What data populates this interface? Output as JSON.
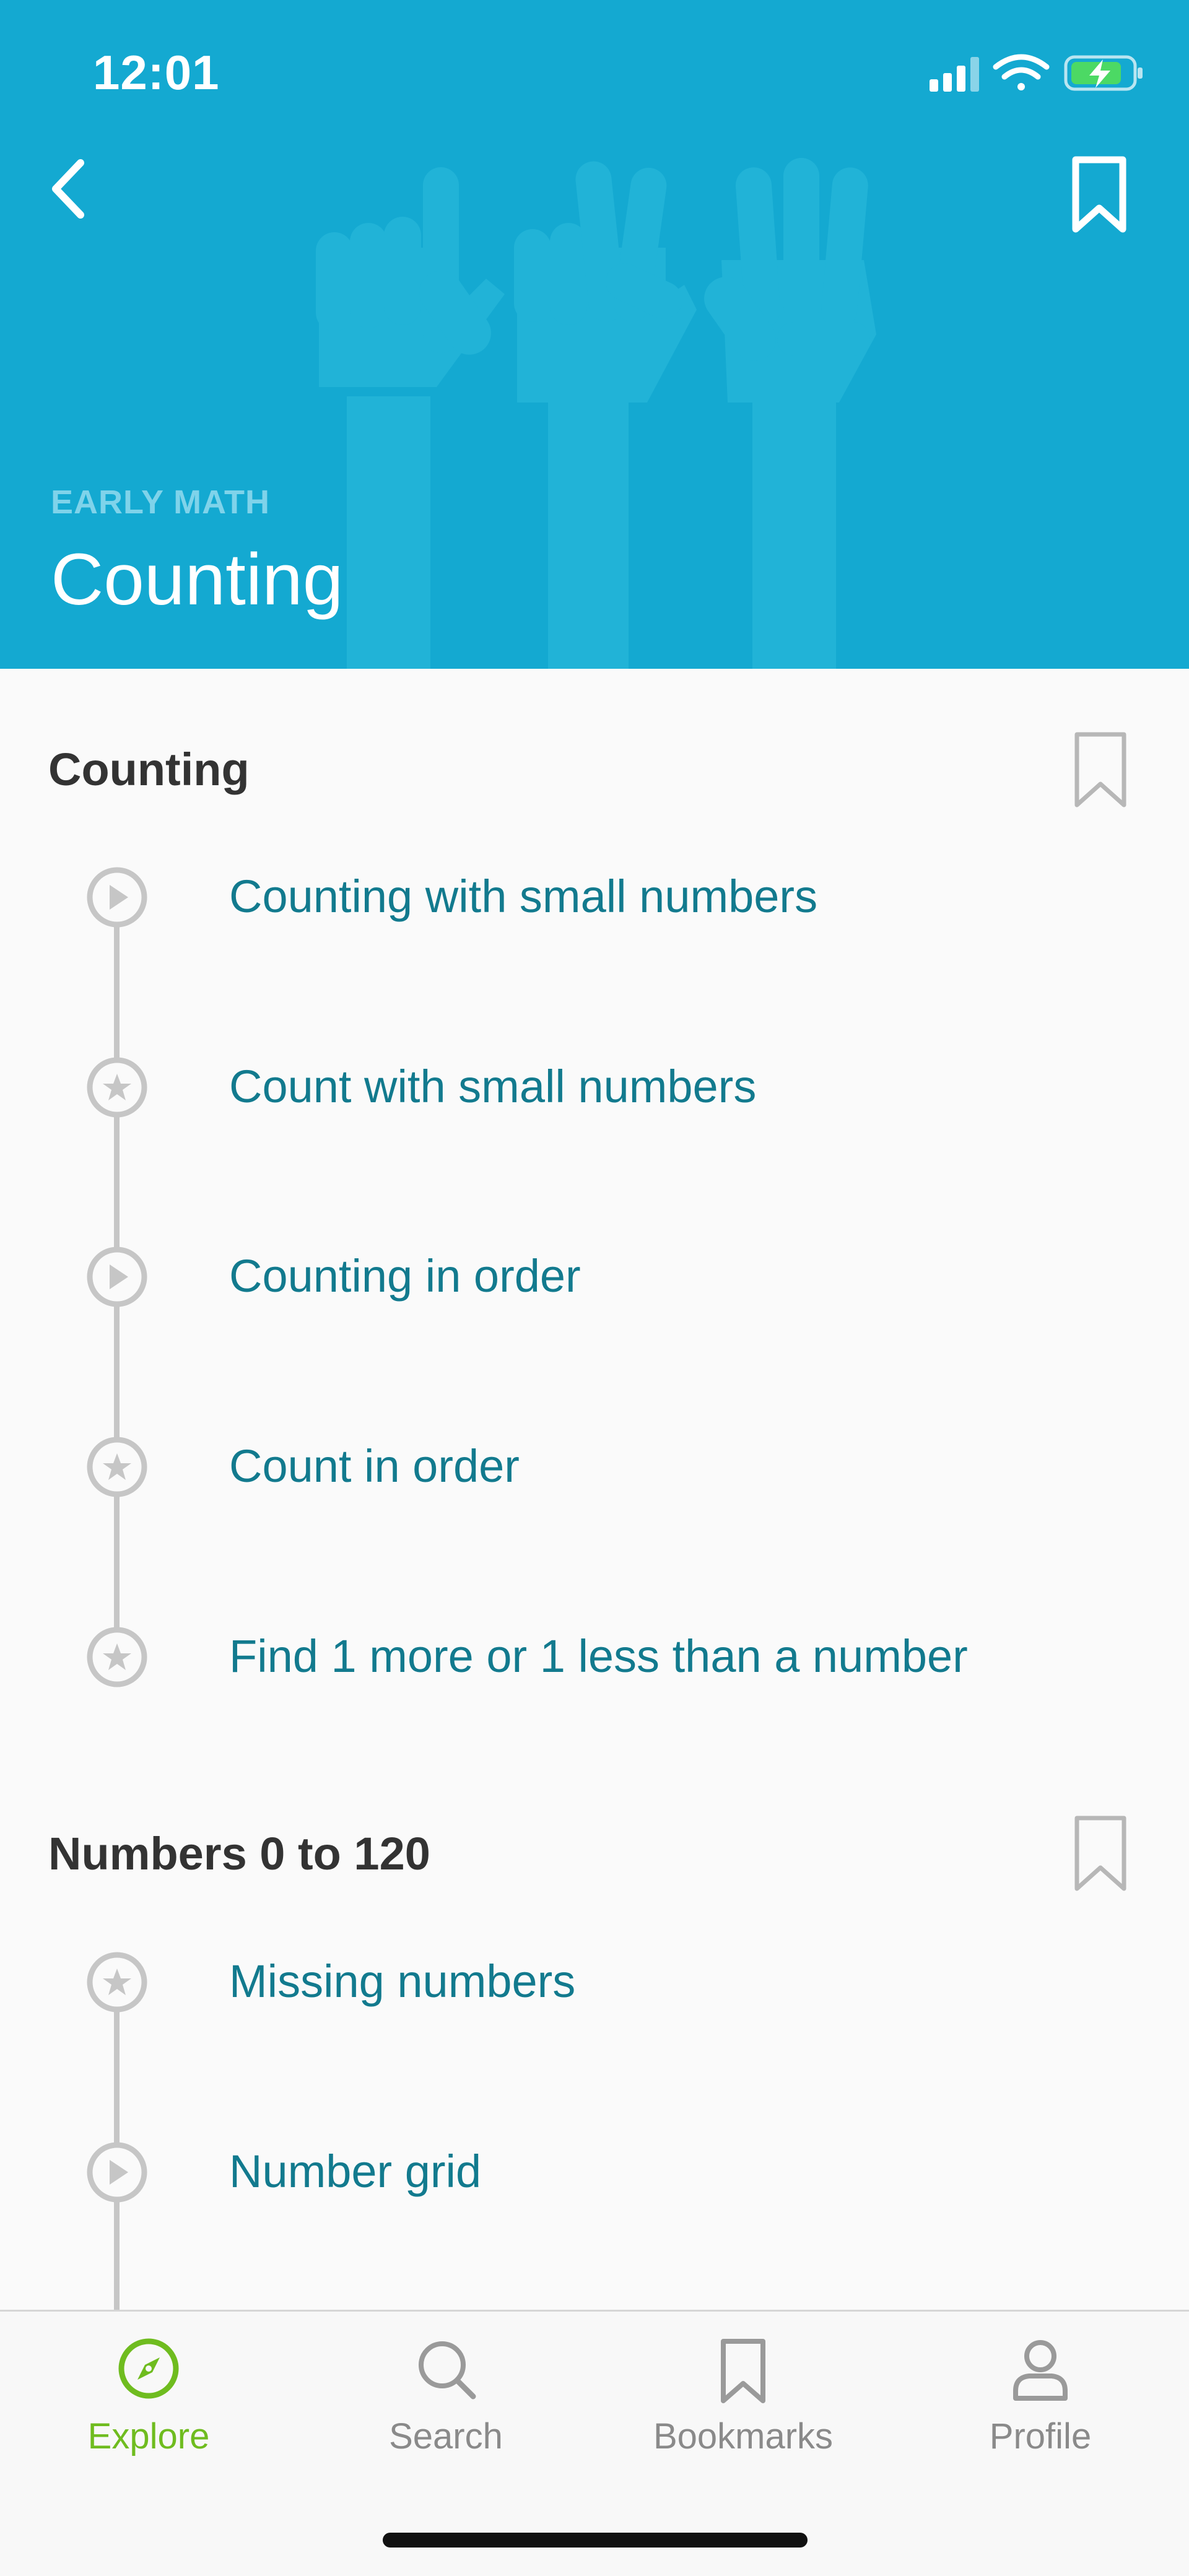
{
  "status_bar": {
    "time": "12:01"
  },
  "header": {
    "subject": "EARLY MATH",
    "title": "Counting",
    "colors": {
      "background": "#14a9d1",
      "subject": "#7fd3ea"
    },
    "icons": {
      "back": "chevron-left-icon",
      "bookmark": "bookmark-icon"
    }
  },
  "sections": [
    {
      "title": "Counting",
      "items": [
        {
          "label": "Counting with small numbers",
          "type": "video"
        },
        {
          "label": "Count with small numbers",
          "type": "exercise"
        },
        {
          "label": "Counting in order",
          "type": "video"
        },
        {
          "label": "Count in order",
          "type": "exercise"
        },
        {
          "label": "Find 1 more or 1 less than a number",
          "type": "exercise"
        }
      ]
    },
    {
      "title": "Numbers 0 to 120",
      "items": [
        {
          "label": "Missing numbers",
          "type": "exercise"
        },
        {
          "label": "Number grid",
          "type": "video"
        }
      ]
    }
  ],
  "tabbar": {
    "active": "explore",
    "tabs": [
      {
        "label": "Explore",
        "icon": "compass-icon"
      },
      {
        "label": "Search",
        "icon": "search-icon"
      },
      {
        "label": "Bookmarks",
        "icon": "bookmark-icon"
      },
      {
        "label": "Profile",
        "icon": "person-icon"
      }
    ],
    "colors": {
      "active": "#6fbc1f",
      "inactive": "#8a8a8a"
    }
  },
  "colors": {
    "item_text": "#127a8e",
    "section_text": "#333333",
    "timeline": "#c6c6c6"
  }
}
